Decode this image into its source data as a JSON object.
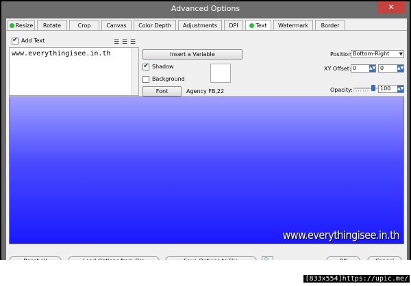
{
  "window": {
    "title": "Advanced Options",
    "close_glyph": "✕"
  },
  "tabs": [
    {
      "label": "Resize",
      "dot": true
    },
    {
      "label": "Rotate"
    },
    {
      "label": "Crop"
    },
    {
      "label": "Canvas"
    },
    {
      "label": "Color Depth"
    },
    {
      "label": "Adjustments"
    },
    {
      "label": "DPI"
    },
    {
      "label": "Text",
      "dot": true,
      "active": true
    },
    {
      "label": "Watermark"
    },
    {
      "label": "Border"
    }
  ],
  "text_panel": {
    "add_text_label": "Add Text",
    "add_text_checked": true,
    "text_value": "www.everythingisee.in.th",
    "insert_variable_label": "Insert a Variable",
    "shadow_label": "Shadow",
    "shadow_checked": true,
    "background_label": "Background",
    "background_checked": false,
    "font_button_label": "Font",
    "font_value": "Agency FB,22",
    "position_label": "Position:",
    "position_value": "Bottom-Right",
    "xy_offset_label": "XY Offset:",
    "x_offset": "0",
    "y_offset": "0",
    "opacity_label": "Opacity:",
    "opacity_value": "100",
    "opacity_fraction": 0.75
  },
  "preview": {
    "watermark_text": "www.everythingisee.in.th"
  },
  "buttons": {
    "reset_all": "Reset all",
    "load_options": "Load Options from File",
    "save_options": "Save Options to File",
    "ok": "OK",
    "cancel": "Cancel"
  },
  "image_footer": "[833x554]https://upic.me/",
  "colors": {
    "accent": "#3c6fb8",
    "status_dot": "#2bbd35",
    "preview_top": "#a0a0ff",
    "preview_bottom": "#1818ff",
    "close": "#c7423d"
  },
  "icons": [
    "align-left-icon",
    "align-center-icon",
    "align-right-icon",
    "preview-icon",
    "close-icon"
  ]
}
